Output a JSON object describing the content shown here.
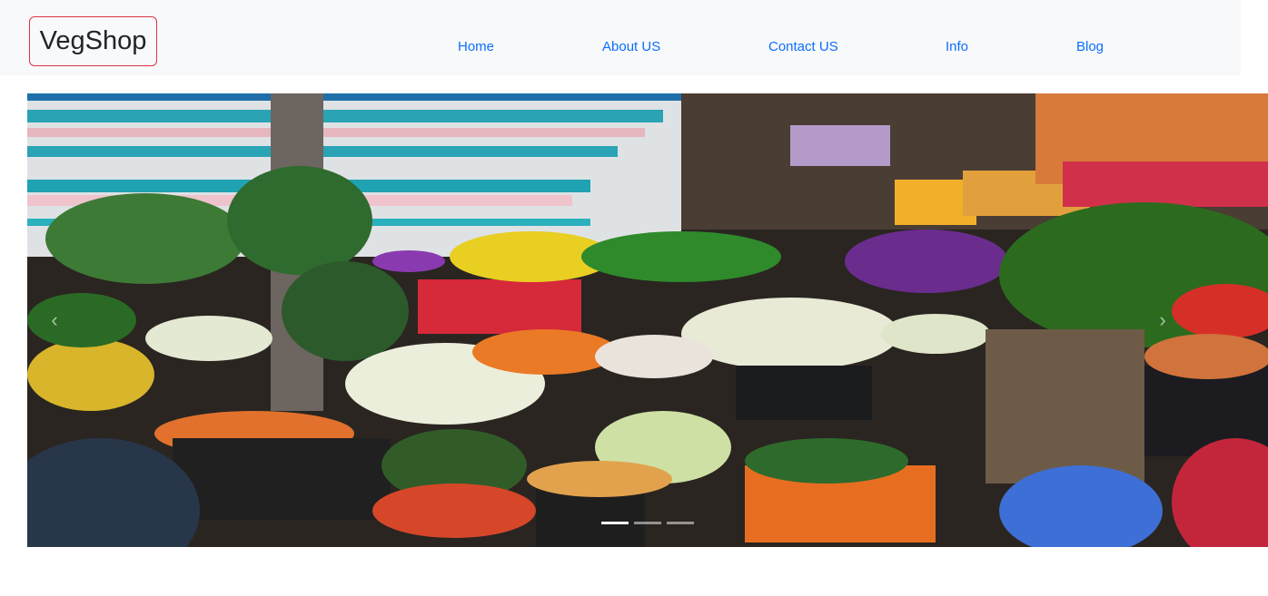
{
  "navbar": {
    "brand": "VegShop",
    "links": [
      "Home",
      "About US",
      "Contact US",
      "Info",
      "Blog"
    ]
  },
  "carousel": {
    "image_description_icon": "vegetable-market-photo",
    "slides_total": 3,
    "active_slide": 1
  }
}
